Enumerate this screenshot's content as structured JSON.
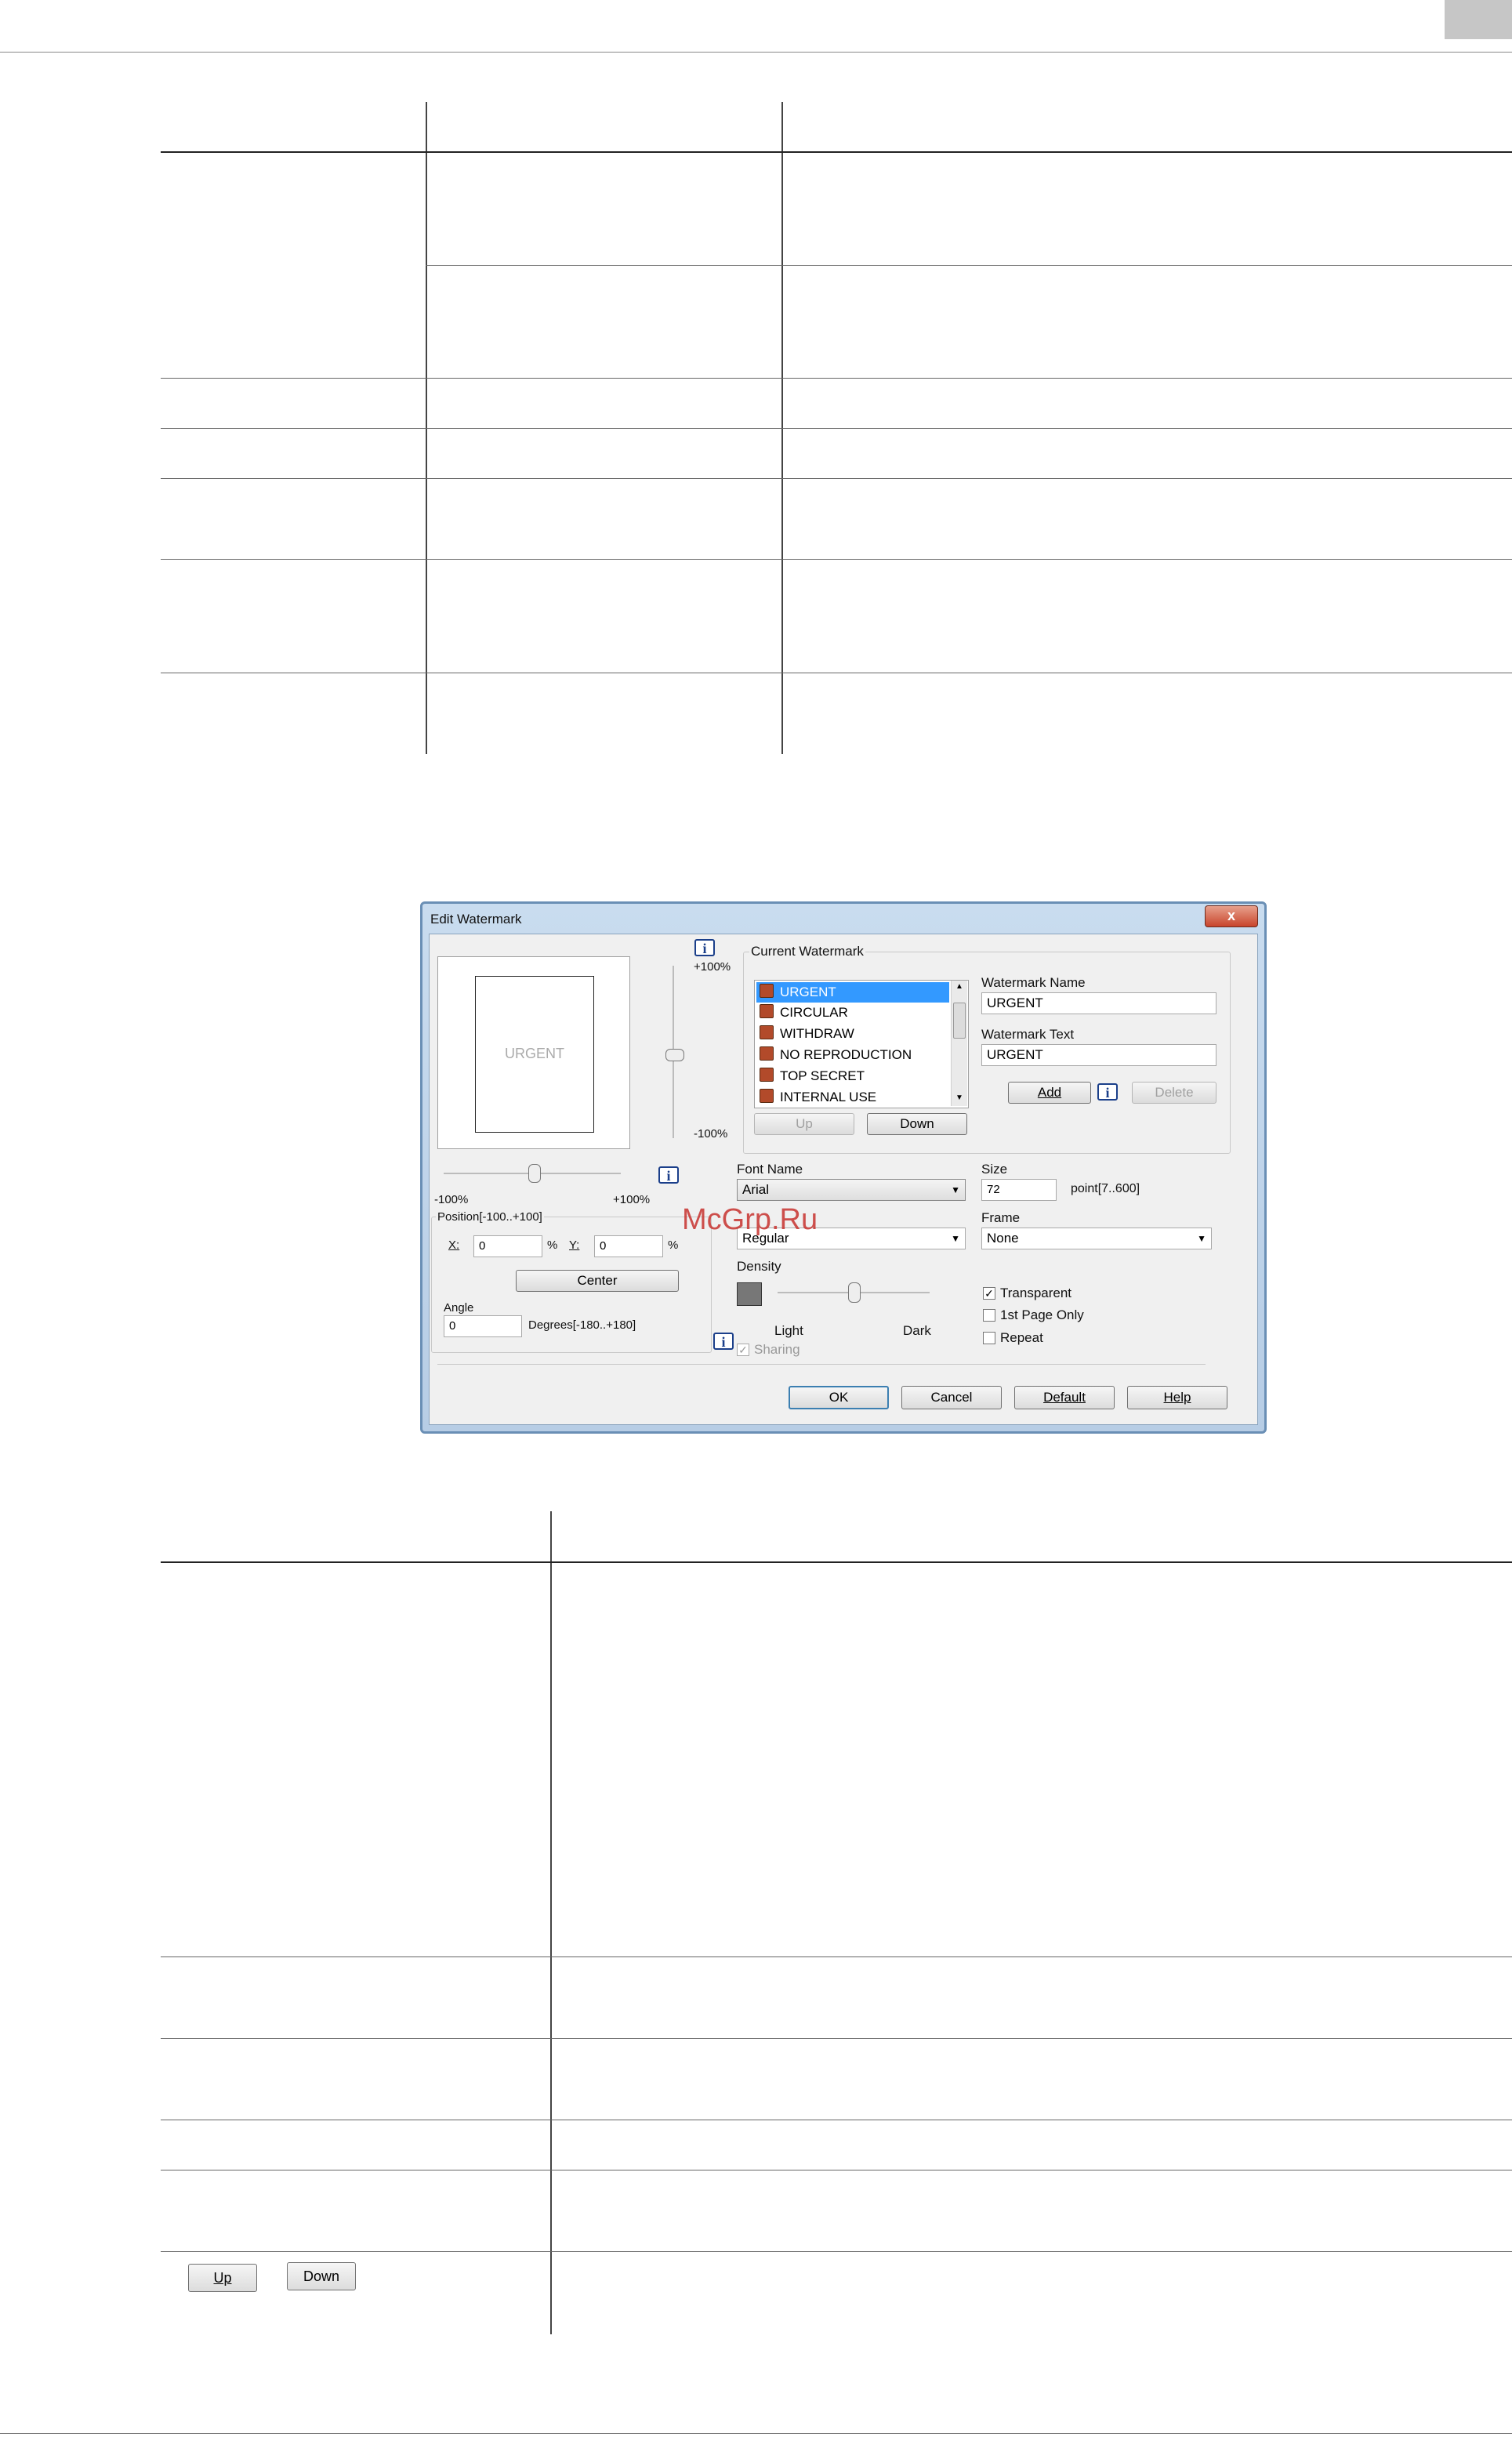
{
  "page": {
    "corner_tab_color": "#c6c6c6"
  },
  "dialog": {
    "title": "Edit Watermark",
    "close_label": "x",
    "preview_text": "URGENT",
    "vertical_scale_top": "+100%",
    "vertical_scale_bottom": "-100%",
    "horizontal_scale_left": "-100%",
    "horizontal_scale_right": "+100%",
    "position_label": "Position[-100..+100]",
    "x_label": "X:",
    "x_value": "0",
    "x_unit": "%",
    "y_label": "Y:",
    "y_value": "0",
    "y_unit": "%",
    "center_button": "Center",
    "angle_label": "Angle",
    "angle_value": "0",
    "angle_range": "Degrees[-180..+180]",
    "current_watermark_label": "Current Watermark",
    "watermarks": [
      "URGENT",
      "CIRCULAR",
      "WITHDRAW",
      "NO REPRODUCTION",
      "TOP SECRET",
      "INTERNAL USE"
    ],
    "up_button": "Up",
    "down_button": "Down",
    "watermark_name_label": "Watermark Name",
    "watermark_name_value": "URGENT",
    "watermark_text_label": "Watermark Text",
    "watermark_text_value": "URGENT",
    "add_button": "Add",
    "delete_button": "Delete",
    "font_name_label": "Font Name",
    "font_name_value": "Arial",
    "style_value": "Regular",
    "size_label": "Size",
    "size_value": "72",
    "size_range": "point[7..600]",
    "frame_label": "Frame",
    "frame_value": "None",
    "density_label": "Density",
    "density_light": "Light",
    "density_dark": "Dark",
    "transparent_label": "Transparent",
    "first_page_label": "1st Page Only",
    "repeat_label": "Repeat",
    "sharing_label": "Sharing",
    "ok_button": "OK",
    "cancel_button": "Cancel",
    "default_button": "Default",
    "help_button": "Help"
  },
  "site_watermark": "McGrp.Ru",
  "lower_table": {
    "up_button": "Up",
    "down_button": "Down"
  },
  "colors": {
    "list_selection": "#3399ff",
    "dialog_frame": "#6a8fb5",
    "site_watermark": "#c8322f"
  }
}
